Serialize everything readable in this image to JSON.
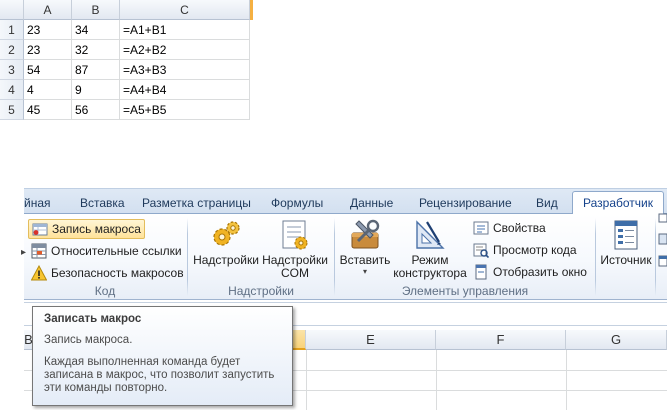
{
  "top_sheet": {
    "columns": [
      "A",
      "B",
      "C"
    ],
    "rows": [
      {
        "num": "1",
        "a": "23",
        "b": "34",
        "c": "=A1+B1"
      },
      {
        "num": "2",
        "a": "23",
        "b": "32",
        "c": "=A2+B2"
      },
      {
        "num": "3",
        "a": "54",
        "b": "87",
        "c": "=A3+B3"
      },
      {
        "num": "4",
        "a": "4",
        "b": "9",
        "c": "=A4+B4"
      },
      {
        "num": "5",
        "a": "45",
        "b": "56",
        "c": "=A5+B5"
      }
    ]
  },
  "ribbon": {
    "tabs": [
      "йная",
      "Вставка",
      "Разметка страницы",
      "Формулы",
      "Данные",
      "Рецензирование",
      "Вид",
      "Разработчик"
    ],
    "active_tab": "Разработчик",
    "groups": {
      "code": {
        "label": "Код",
        "record_macro": "Запись макроса",
        "relative_refs": "Относительные ссылки",
        "macro_security": "Безопасность макросов"
      },
      "addins": {
        "label": "Надстройки",
        "addins_button": "Надстройки",
        "com_addins_line1": "Надстройки",
        "com_addins_line2": "COM"
      },
      "controls": {
        "label": "Элементы управления",
        "insert": "Вставить",
        "design_mode_line1": "Режим",
        "design_mode_line2": "конструктора",
        "properties": "Свойства",
        "view_code": "Просмотр кода",
        "show_window": "Отобразить окно"
      },
      "xml": {
        "source": "Источник"
      }
    }
  },
  "grid": {
    "columns": [
      "B",
      "",
      "E",
      "F",
      "G"
    ]
  },
  "tooltip": {
    "title": "Записать макрос",
    "line1": "Запись макроса.",
    "description": "Каждая выполненная команда будет записана в макрос, что позволит запустить эти команды повторно."
  },
  "colors": {
    "accent": "#15428b",
    "selected_header": "#f9d37a",
    "hover_button": "#ffe29a"
  }
}
